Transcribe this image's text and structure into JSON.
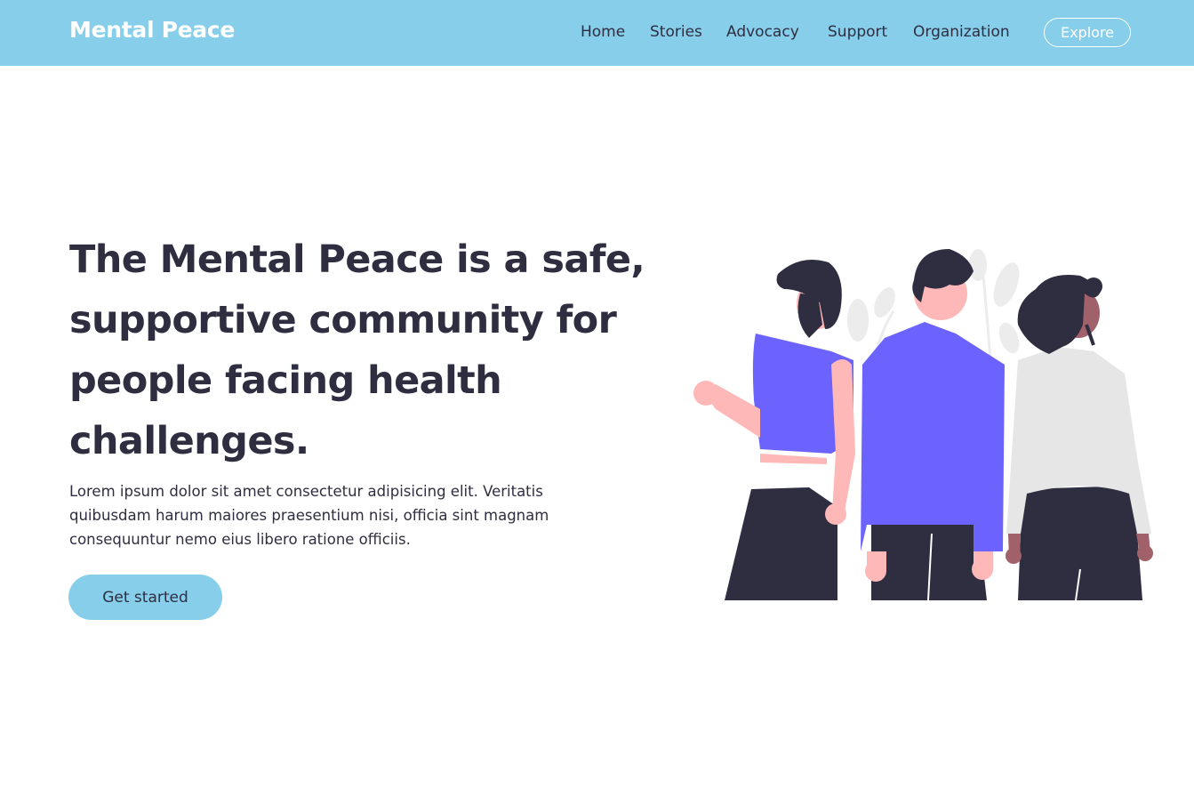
{
  "brand": {
    "name": "Mental Peace"
  },
  "nav": {
    "links": [
      {
        "label": "Home"
      },
      {
        "label": "Stories"
      },
      {
        "label": "Advocacy"
      },
      {
        "label": "Support"
      },
      {
        "label": "Organization"
      }
    ],
    "cta_label": "Explore"
  },
  "hero": {
    "title": "The Mental Peace is a safe, supportive community for people facing health challenges.",
    "description": "Lorem ipsum dolor sit amet consectetur adipisicing elit. Veritatis quibusdam harum maiores praesentium nisi, officia sint magnam consequuntur nemo eius libero ratione officiis.",
    "button_label": "Get started"
  },
  "colors": {
    "navbar": "#87ceeb",
    "text_dark": "#2f2e41",
    "accent_purple": "#6c63ff",
    "skin_light": "#ffb8b8",
    "skin_dark": "#a0616a",
    "sweater_gray": "#e6e6e6"
  },
  "illustration": {
    "name": "three-people-illustration"
  }
}
